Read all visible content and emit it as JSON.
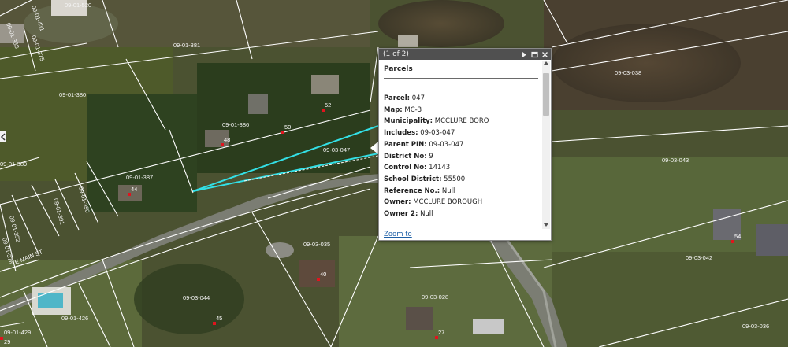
{
  "popup": {
    "counter": "(1 of 2)",
    "header": "Parcels",
    "fields": [
      {
        "label": "Parcel:",
        "value": "047"
      },
      {
        "label": "Map:",
        "value": "MC-3"
      },
      {
        "label": "Municipality:",
        "value": "MCCLURE BORO"
      },
      {
        "label": "Includes:",
        "value": "09-03-047"
      },
      {
        "label": "Parent PIN:",
        "value": "09-03-047"
      },
      {
        "label": "District No:",
        "value": "9"
      },
      {
        "label": "Control No:",
        "value": "14143"
      },
      {
        "label": "School District:",
        "value": "55500"
      },
      {
        "label": "Reference No.:",
        "value": "Null"
      },
      {
        "label": "Owner:",
        "value": "MCCLURE BOROUGH"
      },
      {
        "label": "Owner 2:",
        "value": "Null"
      }
    ],
    "zoom_label": "Zoom to"
  },
  "street_label": "E MAIN ST",
  "parcel_labels": [
    "09-01-520",
    "09-01-431",
    "09-01-338",
    "09-01-381",
    "09-01-380",
    "09-01-386",
    "09-01-387",
    "09-01-389",
    "09-01-390",
    "09-01-391",
    "09-01-392",
    "09-01-426",
    "09-01-429",
    "09-01-376",
    "09-01-375",
    "09-03-047",
    "09-03-035",
    "09-03-044",
    "09-03-028",
    "09-03-038",
    "09-03-043",
    "09-03-042",
    "09-03-036"
  ],
  "house_numbers": [
    "52",
    "50",
    "48",
    "44",
    "40",
    "45",
    "27",
    "54",
    "29"
  ],
  "colors": {
    "parcel_lines": "#ffffff",
    "selection": "#33e0e6",
    "house_marker": "#e0141e",
    "popup_title_bar": "#505050",
    "link": "#1d5fa6"
  },
  "icons": {
    "next": "play-icon",
    "maximize": "maximize-icon",
    "close": "close-icon"
  }
}
